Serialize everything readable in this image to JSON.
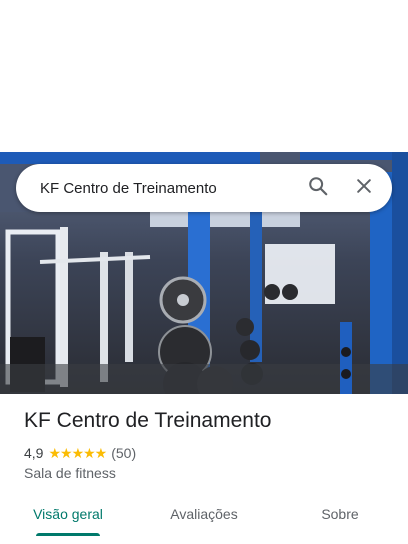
{
  "search": {
    "query": "KF Centro de Treinamento",
    "search_icon": "search-icon",
    "close_icon": "close-icon"
  },
  "hero": {
    "image": "gym-interior-photo"
  },
  "place": {
    "name": "KF Centro de Treinamento",
    "rating": "4,9",
    "stars": "★★★★★",
    "star_color": "#fbbc04",
    "review_count": "(50)",
    "category": "Sala de fitness"
  },
  "tabs": [
    {
      "label": "Visão geral",
      "active": true
    },
    {
      "label": "Avaliações",
      "active": false
    },
    {
      "label": "Sobre",
      "active": false
    }
  ],
  "colors": {
    "accent": "#00796b",
    "text_primary": "#202124",
    "text_secondary": "#5f6368"
  }
}
